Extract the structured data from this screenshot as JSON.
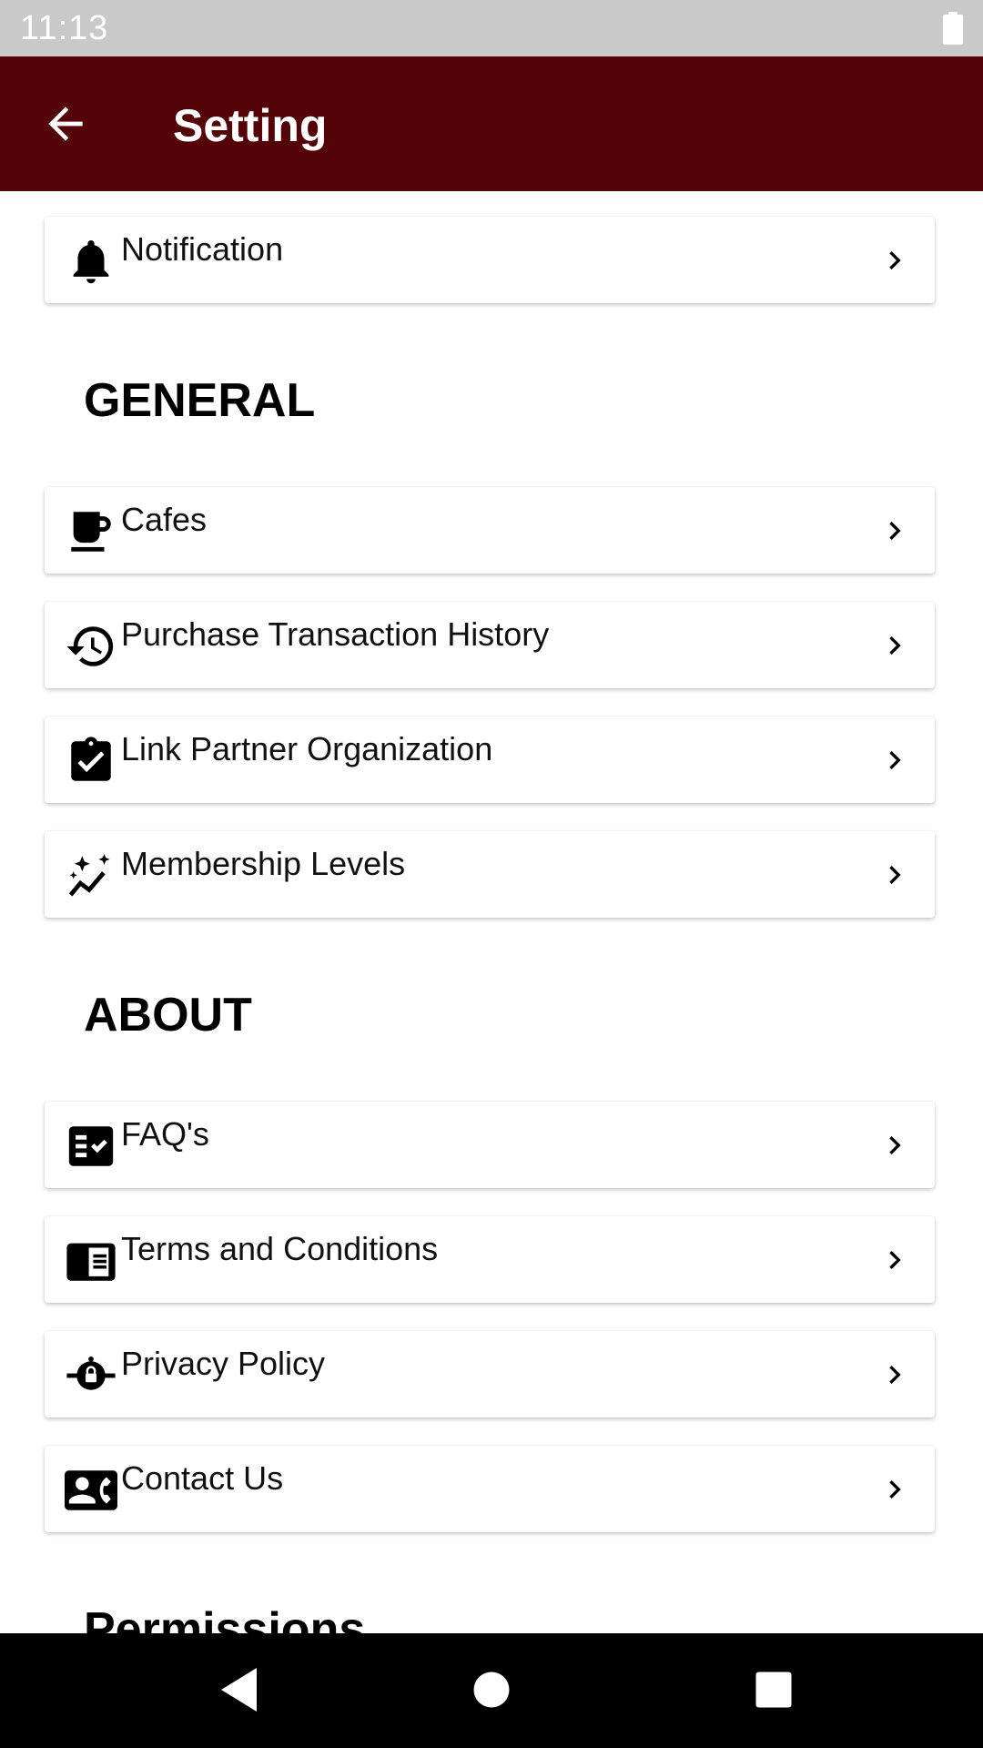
{
  "status_bar": {
    "time": "11:13"
  },
  "app_bar": {
    "title": "Setting"
  },
  "notification": {
    "label": "Notification"
  },
  "general": {
    "heading": "GENERAL",
    "items": [
      {
        "label": "Cafes",
        "icon": "coffee-cup-icon"
      },
      {
        "label": "Purchase Transaction History",
        "icon": "history-icon"
      },
      {
        "label": "Link Partner Organization",
        "icon": "clipboard-check-icon"
      },
      {
        "label": "Membership Levels",
        "icon": "sparkle-trend-icon"
      }
    ]
  },
  "about": {
    "heading": "ABOUT",
    "items": [
      {
        "label": "FAQ's",
        "icon": "faq-checklist-icon"
      },
      {
        "label": "Terms and Conditions",
        "icon": "document-icon"
      },
      {
        "label": "Privacy Policy",
        "icon": "privacy-lock-icon"
      },
      {
        "label": "Contact Us",
        "icon": "contact-card-icon"
      }
    ]
  },
  "permissions": {
    "heading": "Permissions"
  },
  "colors": {
    "app_bar": "#540308",
    "status_bar": "#c9c9c9",
    "nav_bar": "#000000"
  }
}
